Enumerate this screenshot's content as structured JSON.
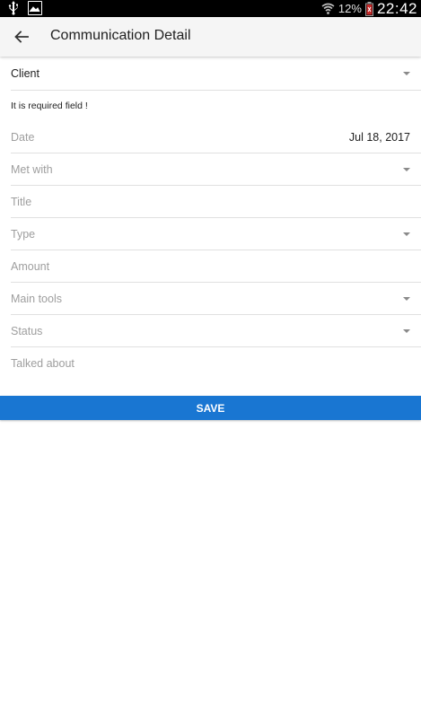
{
  "status_bar": {
    "icons": [
      "usb-icon",
      "photo-icon",
      "wifi-icon",
      "battery-icon"
    ],
    "battery_percent": "12%",
    "time": "22:42"
  },
  "app_bar": {
    "back_icon": "arrow-left-icon",
    "title": "Communication Detail"
  },
  "form": {
    "client": {
      "label": "Client",
      "error": "It is required field !"
    },
    "date": {
      "label": "Date",
      "value": "Jul 18, 2017"
    },
    "met_with": {
      "label": "Met with"
    },
    "title": {
      "label": "Title"
    },
    "type": {
      "label": "Type"
    },
    "amount": {
      "label": "Amount"
    },
    "main_tools": {
      "label": "Main tools"
    },
    "status": {
      "label": "Status"
    },
    "talked_about": {
      "label": "Talked about"
    }
  },
  "save_button": {
    "label": "SAVE"
  },
  "colors": {
    "primary": "#1976d2",
    "status_bar": "#000000",
    "app_bar": "#f5f5f5",
    "hint_text": "#9e9e9e",
    "divider": "#e0e0e0"
  }
}
